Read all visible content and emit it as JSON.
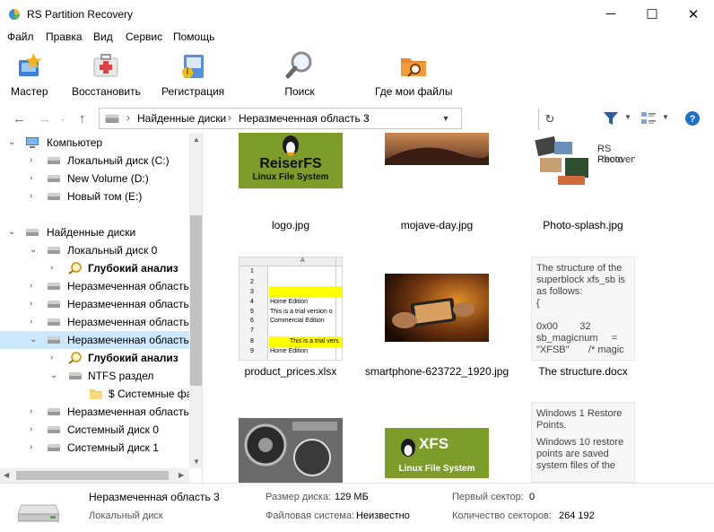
{
  "window": {
    "title": "RS Partition Recovery",
    "minimize": "─",
    "maximize": "☐",
    "close": "✕"
  },
  "menu": [
    "Файл",
    "Правка",
    "Вид",
    "Сервис",
    "Помощь"
  ],
  "toolbar": {
    "wizard": "Мастер",
    "restore": "Восстановить",
    "registration": "Регистрация",
    "search": "Поиск",
    "where_files": "Где мои файлы"
  },
  "address": {
    "segments": [
      "Найденные диски",
      "Неразмеченная область 3"
    ]
  },
  "tree": {
    "computer": "Компьютер",
    "local_c": "Локальный диск (C:)",
    "new_volume_d": "New Volume (D:)",
    "new_tom_e": "Новый том (E:)",
    "found_disks": "Найденные диски",
    "local_disk_0": "Локальный диск 0",
    "deep_analysis": "Глубокий анализ",
    "unallocated": "Неразмеченная область",
    "ntfs": "NTFS раздел",
    "system_folder": "$ Системные фа",
    "system_disk_0": "Системный диск 0",
    "system_disk_1": "Системный диск 1"
  },
  "files": {
    "row1": [
      "logo.jpg",
      "mojave-day.jpg",
      "Photo-splash.jpg"
    ],
    "row2": [
      "product_prices.xlsx",
      "smartphone-623722_1920.jpg",
      "The structure.docx"
    ],
    "reiserfs_line1": "ReiserFS",
    "reiserfs_line2": "Linux File System",
    "xfs_line1": "XFS",
    "xfs_line2": "Linux File System",
    "rs_photo_line1": "RS Photo",
    "rs_photo_line2": "Recovery",
    "doc_text": [
      "The structure of the",
      "superblock xfs_sb is",
      "as follows:",
      "{",
      "",
      "0x00        32",
      "sb_magicnum     =",
      "\"XFSB\"       /* magic"
    ],
    "doc2_text": [
      "Windows 1 Restore",
      "Points.",
      "",
      "Windows 10 restore",
      "points are saved",
      "system files of the"
    ],
    "xlsx_col": "A",
    "xlsx_rows": [
      "1",
      "2",
      "3",
      "4",
      "5",
      "6",
      "7",
      "8",
      "9"
    ],
    "xlsx_home": "Home Edition",
    "xlsx_trial": "This is a trial version o",
    "xlsx_commercial": "Commercial Edition",
    "xlsx_trial2": "This is a trial vers",
    "xlsx_home2": "Home Edition"
  },
  "status": {
    "name": "Неразмеченная область 3",
    "type": "Локальный диск",
    "disk_size_label": "Размер диска:",
    "disk_size": "129 МБ",
    "fs_label": "Файловая система:",
    "fs": "Неизвестно",
    "first_sector_label": "Первый сектор:",
    "first_sector": "0",
    "sector_count_label": "Количество секторов:",
    "sector_count": "264 192"
  }
}
